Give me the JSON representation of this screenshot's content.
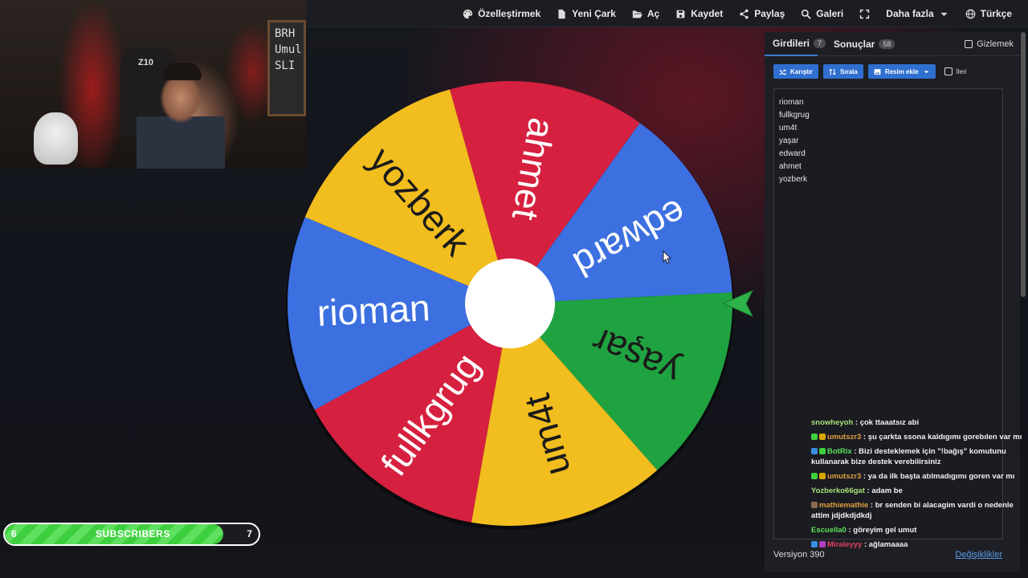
{
  "nav": {
    "items": [
      {
        "label": "Özelleştirmek",
        "icon": "palette-icon"
      },
      {
        "label": "Yeni Çark",
        "icon": "file-icon"
      },
      {
        "label": "Aç",
        "icon": "folder-open-icon"
      },
      {
        "label": "Kaydet",
        "icon": "save-icon"
      },
      {
        "label": "Paylaş",
        "icon": "share-icon"
      },
      {
        "label": "Galeri",
        "icon": "search-icon"
      },
      {
        "label": "",
        "icon": "fullscreen-icon"
      },
      {
        "label": "Daha fazla",
        "icon": "chevron-down-icon"
      },
      {
        "label": "Türkçe",
        "icon": "globe-icon"
      }
    ]
  },
  "webcam": {
    "board_lines": [
      "BRH",
      "Umul",
      "SLI"
    ],
    "chair_logo": "Z10"
  },
  "wheel": {
    "segments": [
      {
        "label": "ahmet",
        "color": "#d6203f"
      },
      {
        "label": "edward",
        "color": "#3c6fe0"
      },
      {
        "label": "yaşar",
        "color": "#1fa341"
      },
      {
        "label": "um4t",
        "color": "#f2bd1e"
      },
      {
        "label": "fullkgrug",
        "color": "#d6203f"
      },
      {
        "label": "rioman",
        "color": "#3c6fe0"
      },
      {
        "label": "yozberk",
        "color": "#f2bd1e"
      }
    ],
    "pointer_color": "#2fb24a"
  },
  "panel": {
    "tabs": [
      {
        "label": "Girdileri",
        "count": "7"
      },
      {
        "label": "Sonuçlar",
        "count": "58"
      }
    ],
    "hide_label": "Gizlemek",
    "toolbar": {
      "shuffle": "Karıştır",
      "sort": "Sırala",
      "add_image": "Resim ekle",
      "advanced": "İleri"
    },
    "entries": [
      "rioman",
      "fullkgrug",
      "um4t",
      "yaşar",
      "edward",
      "ahmet",
      "yozberk"
    ],
    "version": "Versiyon 390",
    "changes": "Değişiklikler"
  },
  "chat": [
    {
      "user": "snowheyoh",
      "user_color": "#a7e07a",
      "text": "çok ttaaatsız abi",
      "badges": []
    },
    {
      "user": "umutszr3",
      "user_color": "#e0a040",
      "text": "şu çarkta ssona kaldıgımı gorebılen var mı",
      "badges": [
        "#3ecf3e",
        "#d8a400"
      ]
    },
    {
      "user": "BotRix",
      "user_color": "#5de05d",
      "text": "Bizi desteklemek için \"!bağış\" komutunu kullanarak bize destek verebilirsiniz",
      "badges": [
        "#3a8de0",
        "#3ecf3e"
      ]
    },
    {
      "user": "umutszr3",
      "user_color": "#e0a040",
      "text": "ya da ilk başta atılmadıgımı goren var mı",
      "badges": [
        "#3ecf3e",
        "#d8a400"
      ]
    },
    {
      "user": "Yozberko66gat",
      "user_color": "#a7e07a",
      "text": "adam be",
      "badges": []
    },
    {
      "user": "mathiemathie",
      "user_color": "#e0a040",
      "text": "br senden bi alacagim vardi o nedenle attim jdjdkdjdkdj",
      "badges": [
        "#8a6a50"
      ]
    },
    {
      "user": "Escuella0",
      "user_color": "#5de05d",
      "text": "göreyim gel umut",
      "badges": []
    },
    {
      "user": "Miraleyyy",
      "user_color": "#e04060",
      "text": "ağlamaaaa",
      "badges": [
        "#3a8de0",
        "#b040c0"
      ]
    }
  ],
  "subscribers": {
    "current": "6",
    "label": "SUBSCRIBERS",
    "goal": "7",
    "progress": 0.86
  }
}
